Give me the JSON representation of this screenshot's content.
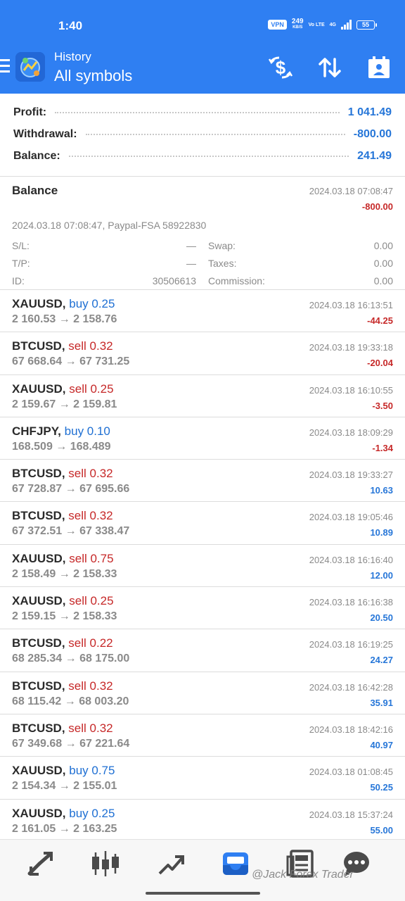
{
  "status_bar": {
    "time": "1:40",
    "vpn": "VPN",
    "speed_value": "249",
    "speed_unit": "KB/S",
    "volte": "Vo LTE",
    "network": "4G",
    "battery": "55"
  },
  "app_bar": {
    "subtitle": "History",
    "title": "All symbols",
    "icons": [
      "menu-icon",
      "app-logo",
      "dollar-exchange-icon",
      "sort-icon",
      "calendar-icon"
    ]
  },
  "summary": {
    "profit_label": "Profit:",
    "profit_value": "1 041.49",
    "withdrawal_label": "Withdrawal:",
    "withdrawal_value": "-800.00",
    "balance_label": "Balance:",
    "balance_value": "241.49"
  },
  "balance_detail": {
    "title": "Balance",
    "time": "2024.03.18 07:08:47",
    "amount": "-800.00",
    "comment": "2024.03.18 07:08:47, Paypal-FSA 58922830",
    "sl_label": "S/L:",
    "sl_value": "—",
    "tp_label": "T/P:",
    "tp_value": "—",
    "id_label": "ID:",
    "id_value": "30506613",
    "swap_label": "Swap:",
    "swap_value": "0.00",
    "taxes_label": "Taxes:",
    "taxes_value": "0.00",
    "commission_label": "Commission:",
    "commission_value": "0.00"
  },
  "trades": [
    {
      "symbol": "XAUUSD,",
      "direction": "buy 0.25",
      "side": "buy",
      "prices": "2 160.53 → 2 158.76",
      "time": "2024.03.18 16:13:51",
      "profit": "-44.25",
      "sign": "neg"
    },
    {
      "symbol": "BTCUSD,",
      "direction": "sell 0.32",
      "side": "sell",
      "prices": "67 668.64 → 67 731.25",
      "time": "2024.03.18 19:33:18",
      "profit": "-20.04",
      "sign": "neg"
    },
    {
      "symbol": "XAUUSD,",
      "direction": "sell 0.25",
      "side": "sell",
      "prices": "2 159.67 → 2 159.81",
      "time": "2024.03.18 16:10:55",
      "profit": "-3.50",
      "sign": "neg"
    },
    {
      "symbol": "CHFJPY,",
      "direction": "buy 0.10",
      "side": "buy",
      "prices": "168.509 → 168.489",
      "time": "2024.03.18 18:09:29",
      "profit": "-1.34",
      "sign": "neg"
    },
    {
      "symbol": "BTCUSD,",
      "direction": "sell 0.32",
      "side": "sell",
      "prices": "67 728.87 → 67 695.66",
      "time": "2024.03.18 19:33:27",
      "profit": "10.63",
      "sign": "pos"
    },
    {
      "symbol": "BTCUSD,",
      "direction": "sell 0.32",
      "side": "sell",
      "prices": "67 372.51 → 67 338.47",
      "time": "2024.03.18 19:05:46",
      "profit": "10.89",
      "sign": "pos"
    },
    {
      "symbol": "XAUUSD,",
      "direction": "sell 0.75",
      "side": "sell",
      "prices": "2 158.49 → 2 158.33",
      "time": "2024.03.18 16:16:40",
      "profit": "12.00",
      "sign": "pos"
    },
    {
      "symbol": "XAUUSD,",
      "direction": "sell 0.25",
      "side": "sell",
      "prices": "2 159.15 → 2 158.33",
      "time": "2024.03.18 16:16:38",
      "profit": "20.50",
      "sign": "pos"
    },
    {
      "symbol": "BTCUSD,",
      "direction": "sell 0.22",
      "side": "sell",
      "prices": "68 285.34 → 68 175.00",
      "time": "2024.03.18 16:19:25",
      "profit": "24.27",
      "sign": "pos"
    },
    {
      "symbol": "BTCUSD,",
      "direction": "sell 0.32",
      "side": "sell",
      "prices": "68 115.42 → 68 003.20",
      "time": "2024.03.18 16:42:28",
      "profit": "35.91",
      "sign": "pos"
    },
    {
      "symbol": "BTCUSD,",
      "direction": "sell 0.32",
      "side": "sell",
      "prices": "67 349.68 → 67 221.64",
      "time": "2024.03.18 18:42:16",
      "profit": "40.97",
      "sign": "pos"
    },
    {
      "symbol": "XAUUSD,",
      "direction": "buy 0.75",
      "side": "buy",
      "prices": "2 154.34 → 2 155.01",
      "time": "2024.03.18 01:08:45",
      "profit": "50.25",
      "sign": "pos"
    },
    {
      "symbol": "XAUUSD,",
      "direction": "buy 0.25",
      "side": "buy",
      "prices": "2 161.05 → 2 163.25",
      "time": "2024.03.18 15:37:24",
      "profit": "55.00",
      "sign": "pos"
    }
  ],
  "bottom_nav": {
    "items": [
      "quotes-icon",
      "chart-icon",
      "trade-icon",
      "history-icon",
      "news-icon",
      "chat-icon"
    ],
    "active": "history-icon",
    "watermark": "@Jack Forex Trader"
  },
  "colors": {
    "accent": "#2f7ff2",
    "positive": "#2676d8",
    "negative": "#c62828",
    "buy": "#1e6fd3",
    "sell": "#c62828"
  }
}
